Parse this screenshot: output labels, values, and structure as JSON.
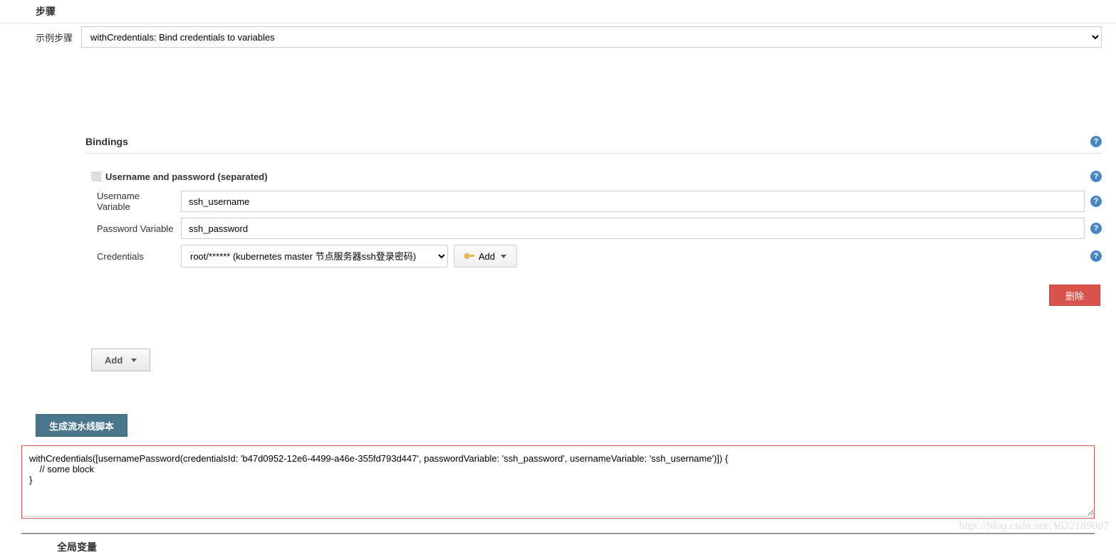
{
  "steps": {
    "section_title": "步骤",
    "sample_label": "示例步骤",
    "selected": "withCredentials: Bind credentials to variables"
  },
  "bindings": {
    "title": "Bindings",
    "type_label": "Username and password (separated)",
    "username_var_label": "Username Variable",
    "username_var_value": "ssh_username",
    "password_var_label": "Password Variable",
    "password_var_value": "ssh_password",
    "credentials_label": "Credentials",
    "credentials_selected": "root/****** (kubernetes master 节点服务器ssh登录密码)",
    "add_cred_label": "Add",
    "delete_label": "删除",
    "add_binding_label": "Add"
  },
  "generate": {
    "button_label": "生成流水线脚本",
    "output": "withCredentials([usernamePassword(credentialsId: 'b47d0952-12e6-4499-a46e-355fd793d447', passwordVariable: 'ssh_password', usernameVariable: 'ssh_username')]) {\n    // some block\n}"
  },
  "global_vars": {
    "title": "全局变量"
  },
  "watermark": "http://blog.csdn.net/A632189007"
}
